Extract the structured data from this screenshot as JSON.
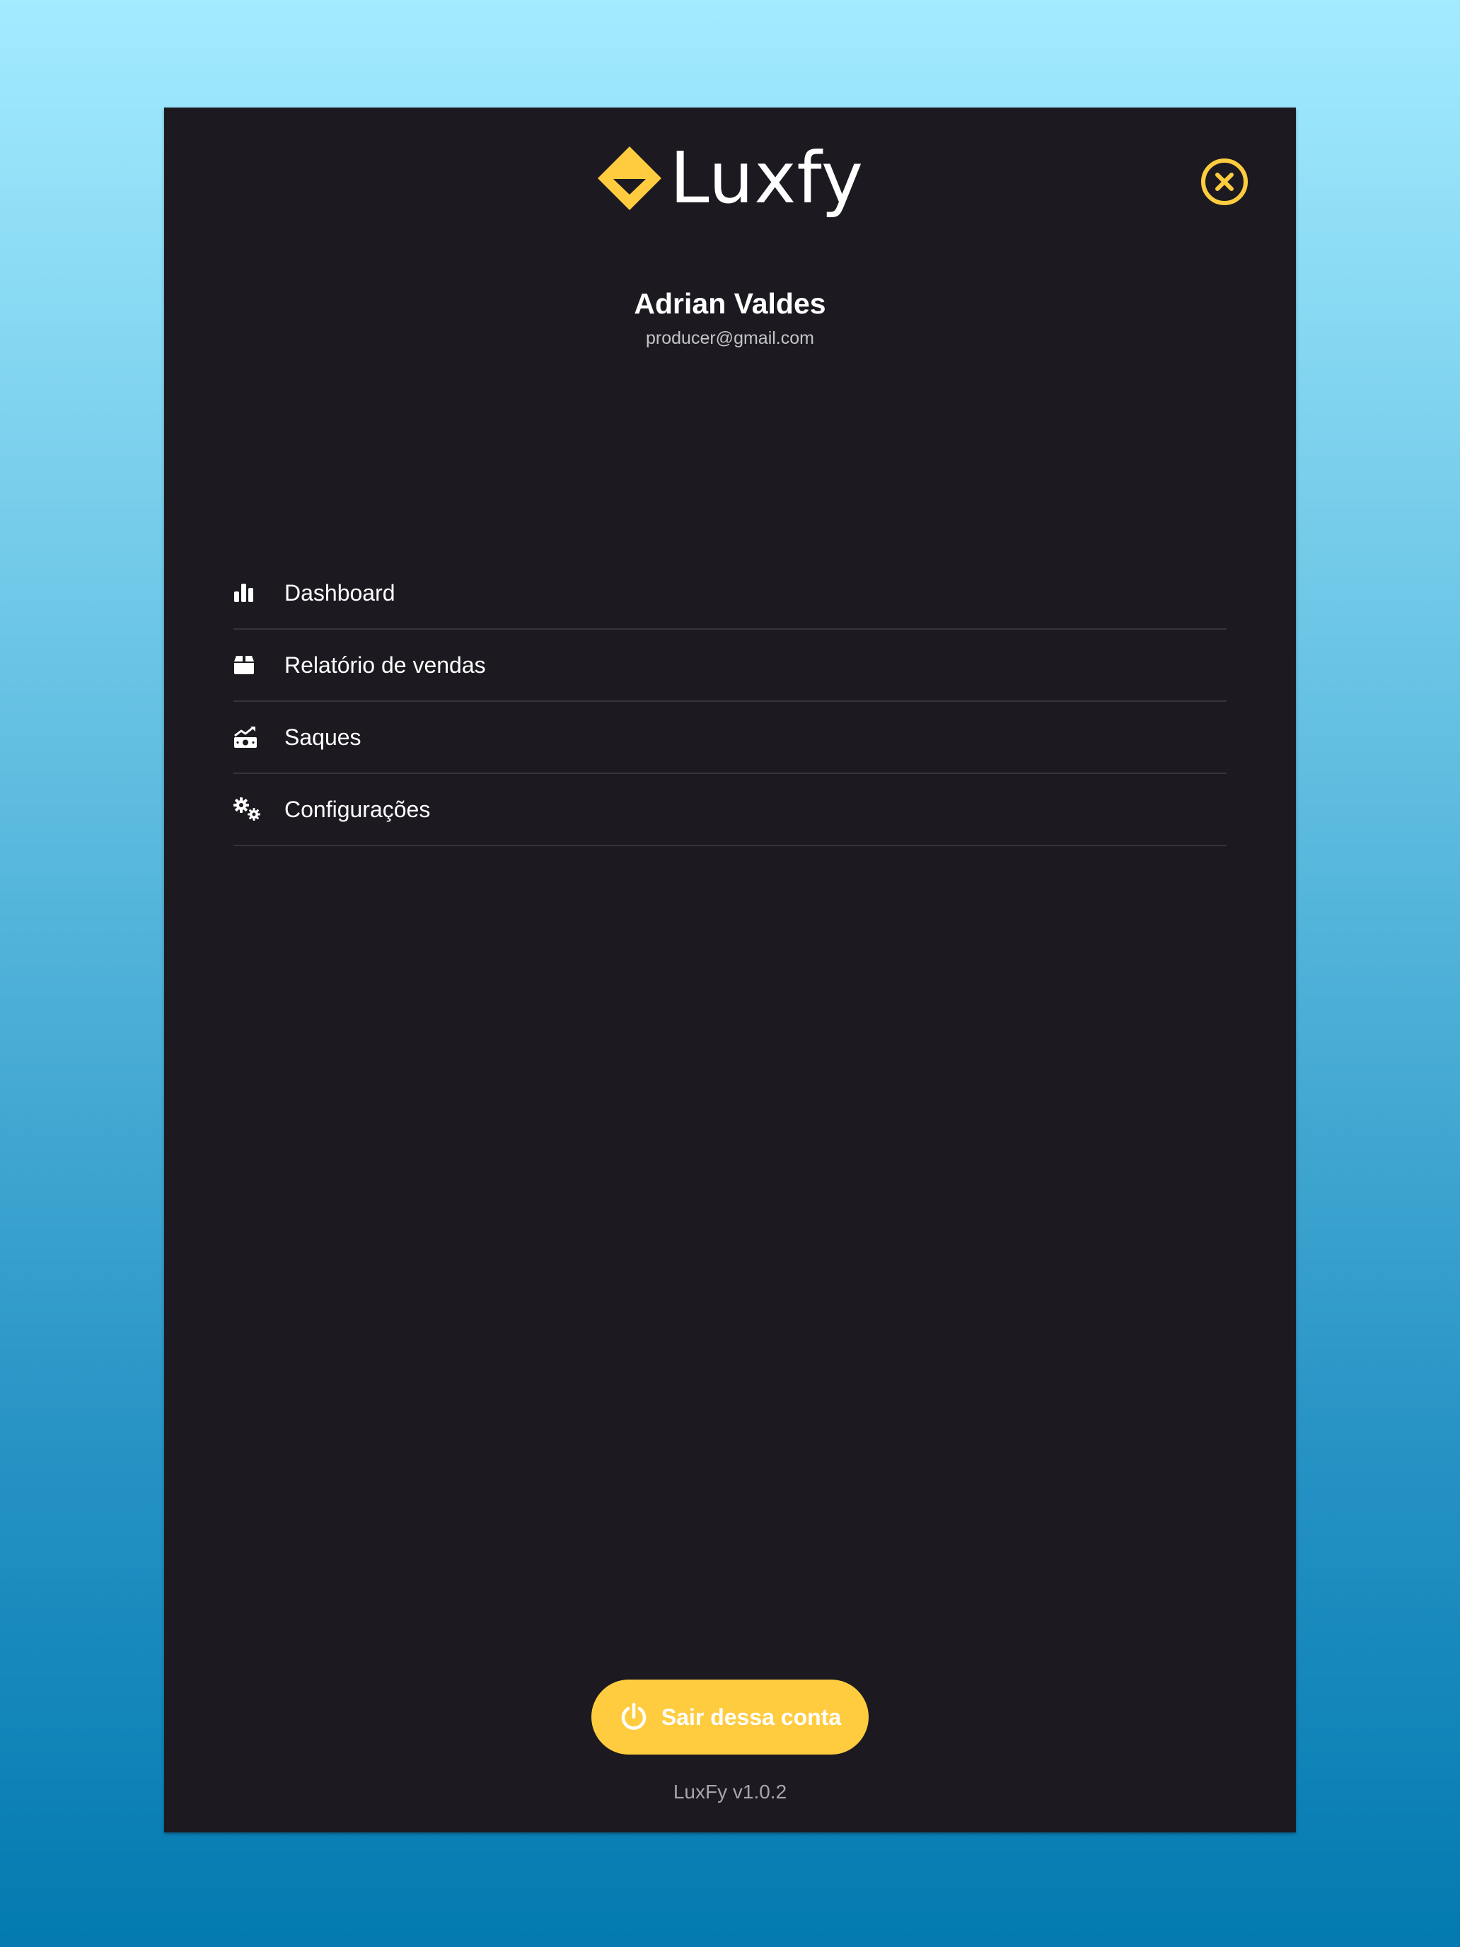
{
  "app": {
    "logo_text": "Luxfy",
    "accent_color": "#ffcc40",
    "panel_color": "#1c1a20"
  },
  "header": {
    "close_icon": "close-circle-icon"
  },
  "user": {
    "name": "Adrian Valdes",
    "email": "producer@gmail.com"
  },
  "menu": {
    "items": [
      {
        "label": "Dashboard",
        "icon": "bar-chart-icon"
      },
      {
        "label": "Relatório de vendas",
        "icon": "box-icon"
      },
      {
        "label": "Saques",
        "icon": "money-trend-icon"
      },
      {
        "label": "Configurações",
        "icon": "gears-icon"
      }
    ]
  },
  "footer": {
    "logout_label": "Sair dessa conta",
    "logout_icon": "power-icon",
    "version": "LuxFy v1.0.2"
  }
}
